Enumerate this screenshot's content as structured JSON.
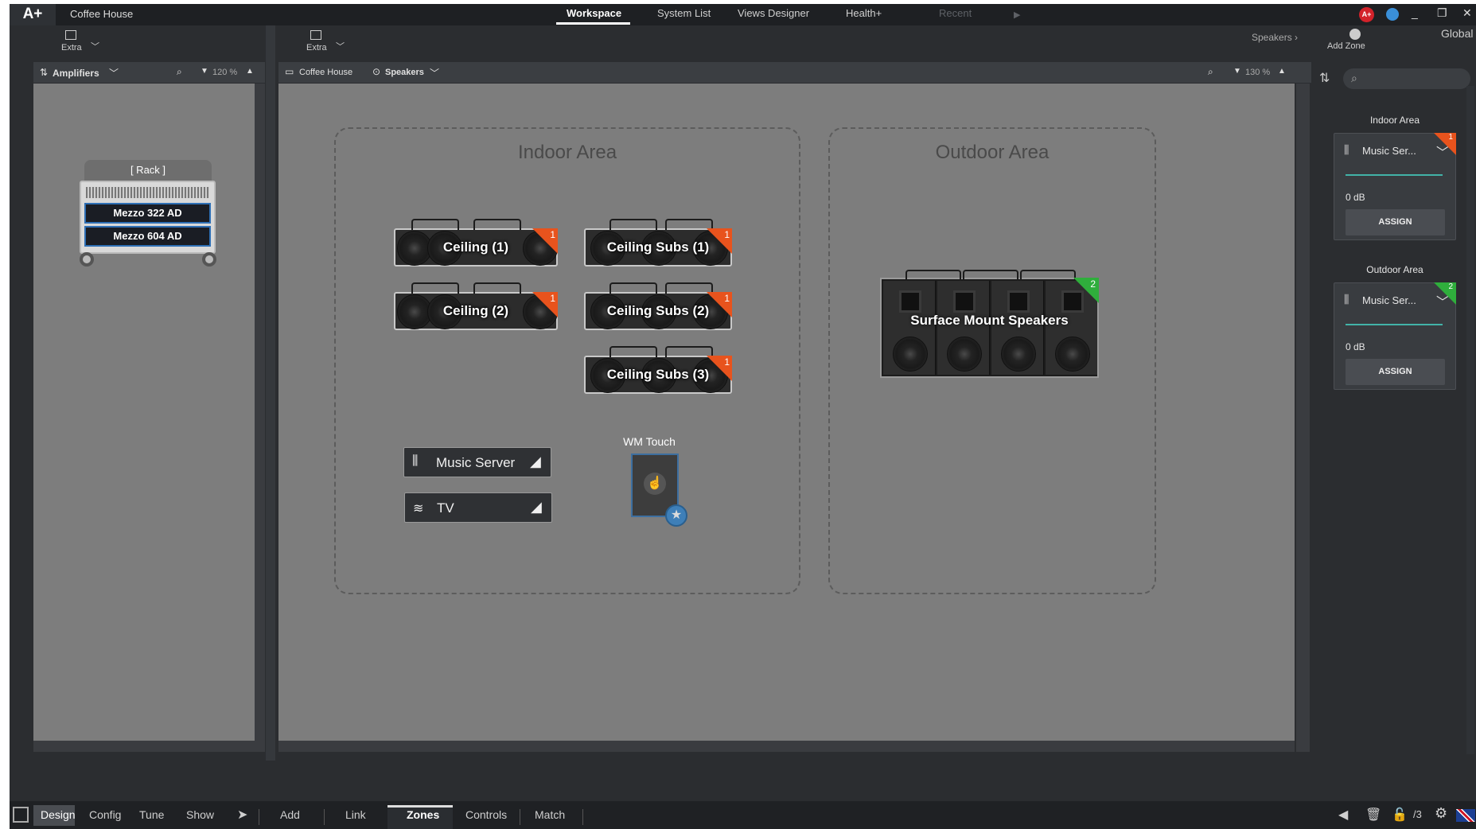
{
  "app": {
    "logo": "A+",
    "project": "Coffee House"
  },
  "tabs": [
    "Workspace",
    "System List",
    "Views Designer",
    "Health+",
    "Recent"
  ],
  "toolbar": {
    "extra_left": "Extra",
    "extra_right": "Extra",
    "speakers_link": "Speakers",
    "add_zone": "Add Zone",
    "global": "Global"
  },
  "left_panel": {
    "header": "Amplifiers",
    "zoom": "120 %",
    "rack_title": "[ Rack ]",
    "amps": [
      "Mezzo 322 AD",
      "Mezzo 604 AD"
    ]
  },
  "main_panel": {
    "breadcrumb": "Coffee House",
    "view": "Speakers",
    "zoom": "130 %"
  },
  "zones": [
    {
      "title": "Indoor Area"
    },
    {
      "title": "Outdoor Area"
    }
  ],
  "speakers": {
    "ceiling1": {
      "label": "Ceiling (1)",
      "badge": "1"
    },
    "ceiling2": {
      "label": "Ceiling (2)",
      "badge": "1"
    },
    "subs1": {
      "label": "Ceiling Subs (1)",
      "badge": "1"
    },
    "subs2": {
      "label": "Ceiling Subs (2)",
      "badge": "1"
    },
    "subs3": {
      "label": "Ceiling Subs (3)",
      "badge": "1"
    },
    "surface": {
      "label": "Surface Mount Speakers",
      "badge": "2"
    }
  },
  "sources": {
    "music": "Music Server",
    "tv": "TV",
    "wm_touch": "WM Touch"
  },
  "right_panel": {
    "zones": [
      {
        "title": "Indoor Area",
        "source": "Music Ser...",
        "level": "0 dB",
        "button": "ASSIGN",
        "badge": "1",
        "color": "#e8531d"
      },
      {
        "title": "Outdoor Area",
        "source": "Music Ser...",
        "level": "0 dB",
        "button": "ASSIGN",
        "badge": "2",
        "color": "#2fae3c"
      }
    ]
  },
  "bottom": {
    "modes": [
      "Design",
      "Config",
      "Tune",
      "Show"
    ],
    "tabs": [
      "Add",
      "Link",
      "Zones",
      "Controls",
      "Match"
    ],
    "page": "/3"
  }
}
